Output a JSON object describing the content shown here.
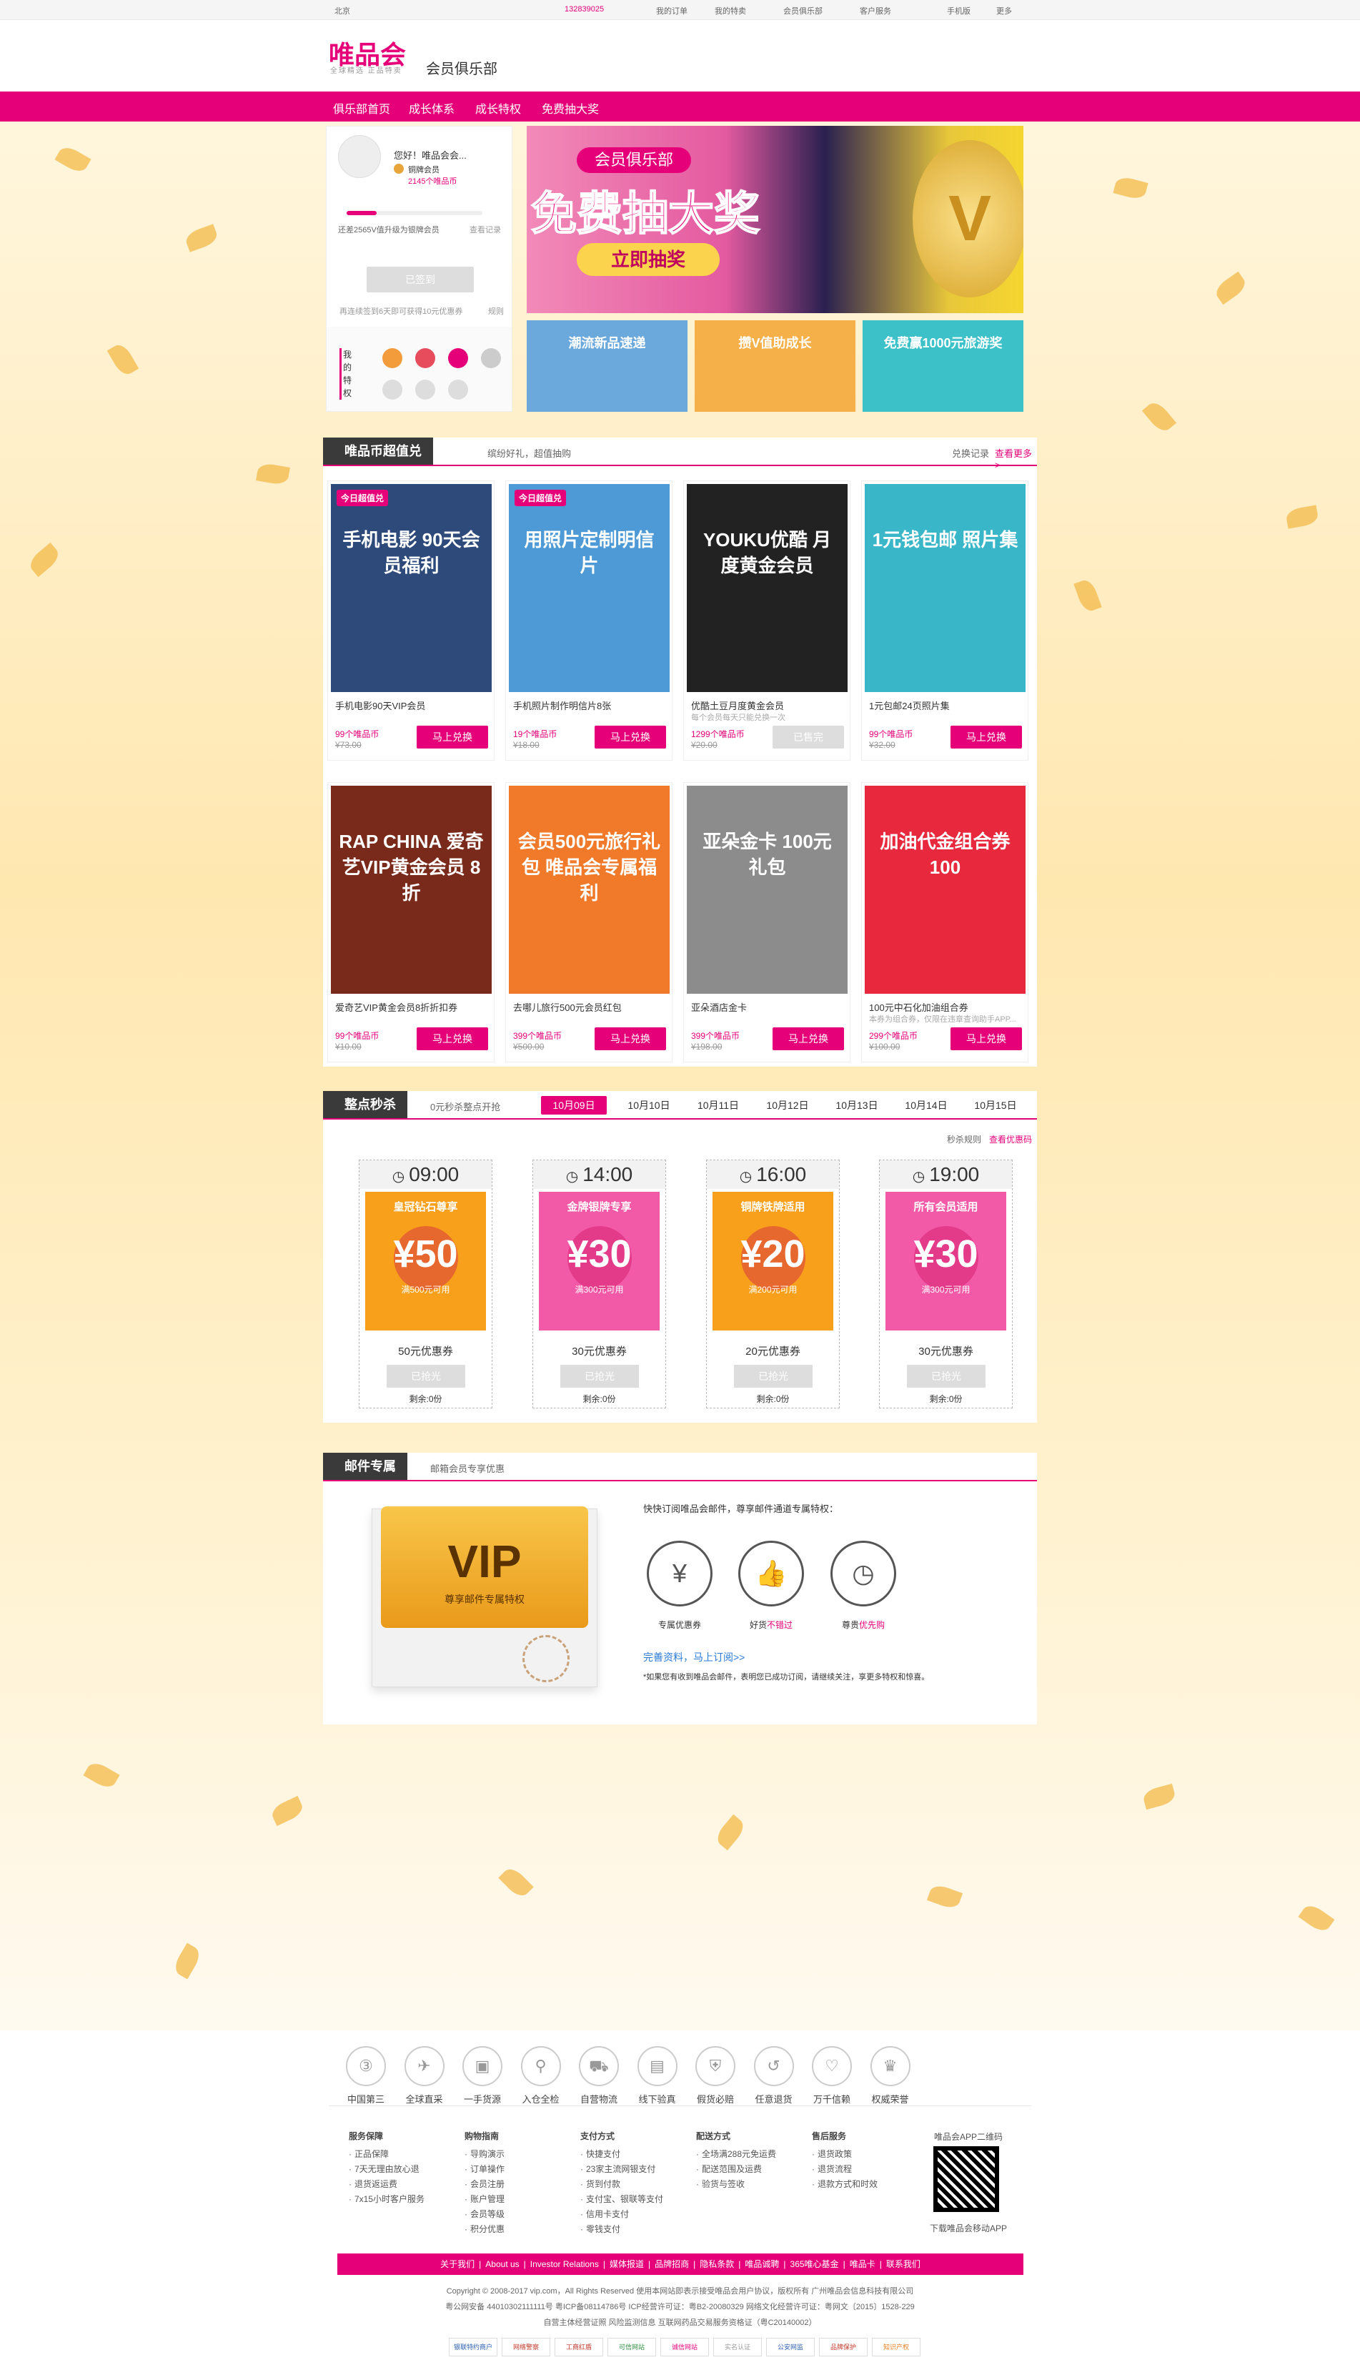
{
  "topbar": {
    "city": "北京",
    "user": "132839025",
    "items": [
      "我的订单",
      "我的特卖",
      "会员俱乐部",
      "客户服务",
      "手机版",
      "更多"
    ]
  },
  "header": {
    "logo": "唯品会",
    "slogan": "全球精选 正品特卖",
    "subtitle": "会员俱乐部"
  },
  "nav": {
    "items": [
      "俱乐部首页",
      "成长体系",
      "成长特权",
      "免费抽大奖"
    ]
  },
  "profile": {
    "greeting": "您好！唯品会会...",
    "level": "铜牌会员",
    "coins": "2145个唯品币",
    "progress_text": "还差2565V值升级为银牌会员",
    "progress_link": "查看记录",
    "signin": "已签到",
    "signin_note": "再连续签到6天即可获得10元优惠券",
    "signin_rule": "规则",
    "privileges_label": "我的特权"
  },
  "banner": {
    "club": "会员俱乐部",
    "title": "免费抽大奖",
    "btn": "立即抽奖"
  },
  "minibanners": [
    "潮流新品速递",
    "攒V值助成长",
    "免费赢1000元旅游奖"
  ],
  "coins_section": {
    "tag": "唯品币超值兑",
    "desc": "缤纷好礼，超值抽购",
    "links": [
      "兑换记录",
      "查看更多>"
    ],
    "products": [
      {
        "img": "手机电影 90天会员福利",
        "badge": "今日超值兑",
        "name": "手机电影90天VIP会员",
        "sub": "",
        "price": "99个唯品币",
        "orig": "¥73.00",
        "btn": "马上兑换",
        "state": "active",
        "color": "#2d4a7a"
      },
      {
        "img": "用照片定制明信片",
        "badge": "今日超值兑",
        "name": "手机照片制作明信片8张",
        "sub": "",
        "price": "19个唯品币",
        "orig": "¥18.00",
        "btn": "马上兑换",
        "state": "active",
        "color": "#4d9ad6"
      },
      {
        "img": "YOUKU优酷 月度黄金会员",
        "badge": "",
        "name": "优酷土豆月度黄金会员",
        "sub": "每个会员每天只能兑换一次",
        "price": "1299个唯品币",
        "orig": "¥20.00",
        "btn": "已售完",
        "state": "soldout",
        "color": "#222222"
      },
      {
        "img": "1元钱包邮 照片集",
        "badge": "",
        "name": "1元包邮24页照片集",
        "sub": "",
        "price": "99个唯品币",
        "orig": "¥32.00",
        "btn": "马上兑换",
        "state": "active",
        "color": "#39b6c8"
      },
      {
        "img": "RAP CHINA 爱奇艺VIP黄金会员 8折",
        "badge": "",
        "name": "爱奇艺VIP黄金会员8折折扣券",
        "sub": "",
        "price": "99个唯品币",
        "orig": "¥10.00",
        "btn": "马上兑换",
        "state": "active",
        "color": "#7a2a1a"
      },
      {
        "img": "会员500元旅行礼包 唯品会专属福利",
        "badge": "",
        "name": "去哪儿旅行500元会员红包",
        "sub": "",
        "price": "399个唯品币",
        "orig": "¥500.00",
        "btn": "马上兑换",
        "state": "active",
        "color": "#f07a2a"
      },
      {
        "img": "亚朵金卡 100元礼包",
        "badge": "",
        "name": "亚朵酒店金卡",
        "sub": "",
        "price": "399个唯品币",
        "orig": "¥198.00",
        "btn": "马上兑换",
        "state": "active",
        "color": "#8c8c8c"
      },
      {
        "img": "加油代金组合券 100",
        "badge": "",
        "name": "100元中石化加油组合券",
        "sub": "本券为组合券，仅限在违章查询助手APP...",
        "price": "299个唯品币",
        "orig": "¥100.00",
        "btn": "马上兑换",
        "state": "active",
        "color": "#e8283c"
      }
    ]
  },
  "seckill": {
    "tag": "整点秒杀",
    "desc": "0元秒杀整点开抢",
    "dates": [
      "10月09日",
      "10月10日",
      "10月11日",
      "10月12日",
      "10月13日",
      "10月14日",
      "10月15日"
    ],
    "rule": "秒杀规则",
    "more": "查看优惠码",
    "coupons": [
      {
        "time": "09:00",
        "head": "皇冠钻石尊享",
        "amount": "¥50",
        "cond": "满500元可用",
        "label": "50元优惠券",
        "btn": "已抢光",
        "left": "剩余:0份",
        "color": "#f8a01c"
      },
      {
        "time": "14:00",
        "head": "金牌银牌专享",
        "amount": "¥30",
        "cond": "满300元可用",
        "label": "30元优惠券",
        "btn": "已抢光",
        "left": "剩余:0份",
        "color": "#f25aa8"
      },
      {
        "time": "16:00",
        "head": "铜牌铁牌适用",
        "amount": "¥20",
        "cond": "满200元可用",
        "label": "20元优惠券",
        "btn": "已抢光",
        "left": "剩余:0份",
        "color": "#f8a01c"
      },
      {
        "time": "19:00",
        "head": "所有会员适用",
        "amount": "¥30",
        "cond": "满300元可用",
        "label": "30元优惠券",
        "btn": "已抢光",
        "left": "剩余:0份",
        "color": "#f25aa8"
      }
    ]
  },
  "mail": {
    "tag": "邮件专属",
    "desc": "邮箱会员专享优惠",
    "vip": "VIP",
    "vip_sub": "尊享邮件专属特权",
    "intro": "快快订阅唯品会邮件，尊享邮件通道专属特权：",
    "benefits": [
      {
        "icon": "¥",
        "label": "专属优惠券",
        "hl": ""
      },
      {
        "icon": "👍",
        "label": "好货",
        "hl": "不错过"
      },
      {
        "icon": "◷",
        "label": "尊贵",
        "hl": "优先购"
      }
    ],
    "link": "完善资料，马上订阅>>",
    "note": "*如果您有收到唯品会邮件，表明您已成功订阅，请继续关注，享更多特权和惊喜。"
  },
  "footer": {
    "features": [
      "中国第三",
      "全球直采",
      "一手货源",
      "入仓全检",
      "自营物流",
      "线下验真",
      "假货必赔",
      "任意退货",
      "万千信赖",
      "权威荣誉"
    ],
    "columns": [
      {
        "title": "服务保障",
        "items": [
          "正品保障",
          "7天无理由放心退",
          "退货返运费",
          "7x15小时客户服务"
        ]
      },
      {
        "title": "购物指南",
        "items": [
          "导购演示",
          "订单操作",
          "会员注册",
          "账户管理",
          "会员等级",
          "积分优惠"
        ]
      },
      {
        "title": "支付方式",
        "items": [
          "快捷支付",
          "23家主流网银支付",
          "货到付款",
          "支付宝、银联等支付",
          "信用卡支付",
          "零钱支付"
        ]
      },
      {
        "title": "配送方式",
        "items": [
          "全场满288元免运费",
          "配送范围及运费",
          "验货与签收"
        ]
      },
      {
        "title": "售后服务",
        "items": [
          "退货政策",
          "退货流程",
          "退款方式和时效"
        ]
      }
    ],
    "qr_title": "唯品会APP二维码",
    "qr_caption": "下载唯品会移动APP",
    "bar_links": [
      "关于我们",
      "About us",
      "Investor Relations",
      "媒体报道",
      "品牌招商",
      "隐私条款",
      "唯品诚聘",
      "365唯心基金",
      "唯品卡",
      "联系我们"
    ],
    "copyright1": "Copyright © 2008-2017 vip.com，All Rights Reserved 使用本网站即表示接受唯品会用户协议，版权所有 广州唯品会信息科技有限公司",
    "copyright2": "粤公网安备 44010302111111号  粤ICP备08114786号  ICP经营许可证：粤B2-20080329  网络文化经营许可证：粤网文〔2015〕1528-229",
    "copyright3": "自营主体经营证照  风险监测信息  互联网药品交易服务资格证（粤C20140002）",
    "badges": [
      "银联特约商户",
      "网络警察",
      "工商红盾",
      "可信网站",
      "诚信网站",
      "实名认证",
      "公安网监",
      "品牌保护",
      "知识产权"
    ]
  }
}
